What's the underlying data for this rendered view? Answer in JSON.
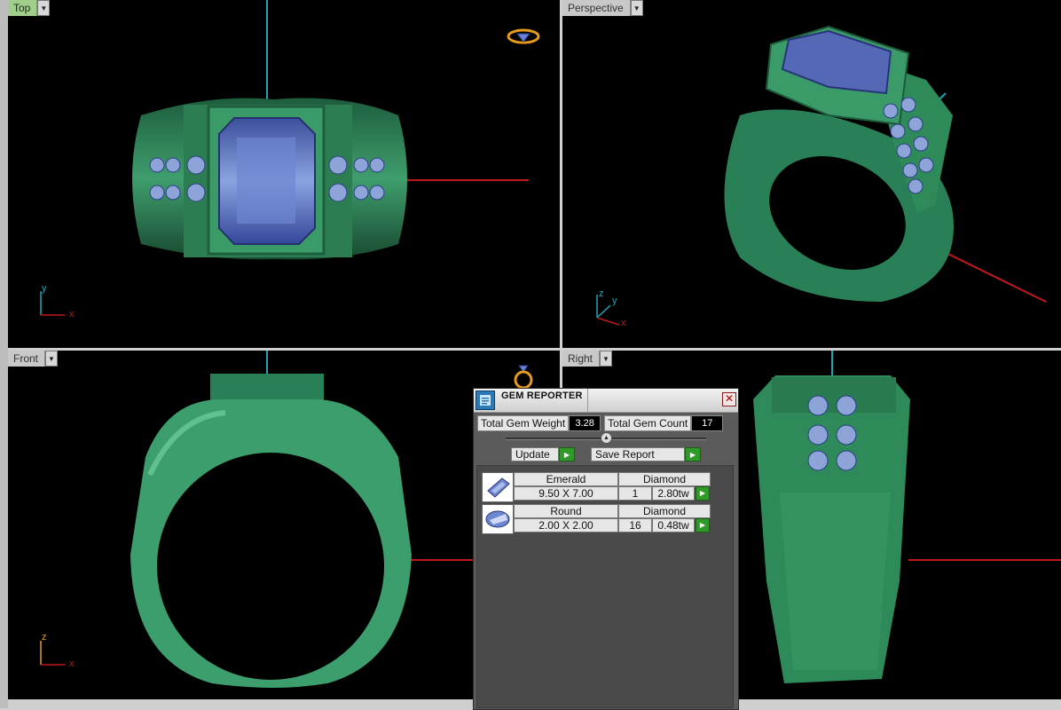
{
  "viewports": {
    "top": {
      "label": "Top",
      "axis_x": "x",
      "axis_y": "y"
    },
    "perspective": {
      "label": "Perspective",
      "axis_x": "x",
      "axis_y": "y",
      "axis_z": "z"
    },
    "front": {
      "label": "Front",
      "axis_x": "x",
      "axis_y": "z"
    },
    "right": {
      "label": "Right"
    }
  },
  "gem_reporter": {
    "title": "GEM REPORTER",
    "total_weight_label": "Total Gem Weight",
    "total_weight_value": "3.28",
    "total_count_label": "Total Gem Count",
    "total_count_value": "17",
    "update_label": "Update",
    "save_label": "Save Report",
    "gems": [
      {
        "shape": "Emerald",
        "material": "Diamond",
        "size": "9.50 X 7.00",
        "count": "1",
        "weight": "2.80tw"
      },
      {
        "shape": "Round",
        "material": "Diamond",
        "size": "2.00 X 2.00",
        "count": "16",
        "weight": "0.48tw"
      }
    ]
  },
  "colors": {
    "metal": "#2f8a5a",
    "gem": "#5a6fc0",
    "axis_red": "#c0181c",
    "axis_cyan": "#1aa6b8",
    "viewport_active": "#9fcf8a"
  },
  "icons": {
    "gem-reporter-app": "gem-report-icon",
    "close": "close-icon",
    "dropdown": "chevron-down-icon"
  }
}
